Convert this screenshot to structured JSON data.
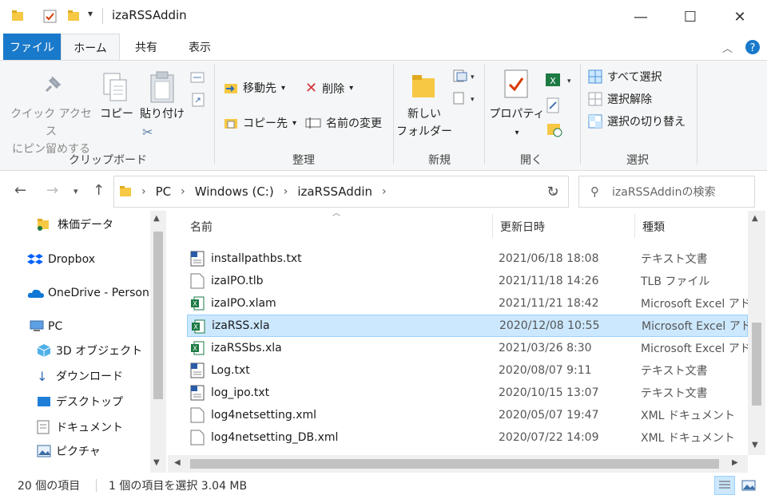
{
  "window": {
    "title": "izaRSSAddin",
    "minimize": "—",
    "maximize": "☐",
    "close": "✕"
  },
  "ribbon_tabs": [
    {
      "label": "ファイル"
    },
    {
      "label": "ホーム"
    },
    {
      "label": "共有"
    },
    {
      "label": "表示"
    }
  ],
  "ribbon": {
    "clipboard": {
      "pin": "クイック アクセス\nにピン留めする",
      "copy": "コピー",
      "paste": "貼り付け",
      "label": "クリップボード"
    },
    "organize": {
      "move_to": "移動先",
      "copy_to": "コピー先",
      "delete": "削除",
      "rename": "名前の変更",
      "label": "整理"
    },
    "new": {
      "new_folder": "新しい\nフォルダー",
      "label": "新規"
    },
    "open": {
      "properties": "プロパティ",
      "label": "開く"
    },
    "select": {
      "select_all": "すべて選択",
      "select_none": "選択解除",
      "invert": "選択の切り替え",
      "label": "選択"
    }
  },
  "address": {
    "crumbs": [
      "PC",
      "Windows (C:)",
      "izaRSSAddin"
    ],
    "search_placeholder": "izaRSSAddinの検索"
  },
  "nav_pane": {
    "items": [
      {
        "label": "株価データ",
        "icon": "folder-icon"
      },
      {
        "label": "Dropbox",
        "icon": "dropbox-icon"
      },
      {
        "label": "OneDrive - Person",
        "icon": "onedrive-icon"
      },
      {
        "label": "PC",
        "icon": "pc-icon"
      },
      {
        "label": "3D オブジェクト",
        "icon": "3d-objects-icon"
      },
      {
        "label": "ダウンロード",
        "icon": "download-icon"
      },
      {
        "label": "デスクトップ",
        "icon": "desktop-icon"
      },
      {
        "label": "ドキュメント",
        "icon": "documents-icon"
      },
      {
        "label": "ピクチャ",
        "icon": "pictures-icon"
      }
    ]
  },
  "columns": {
    "name": "名前",
    "date": "更新日時",
    "type": "種類"
  },
  "files": [
    {
      "name": "installpathbs.txt",
      "date": "2021/06/18 18:08",
      "type": "テキスト文書",
      "icon": "text-file-icon"
    },
    {
      "name": "izaIPO.tlb",
      "date": "2021/11/18 14:26",
      "type": "TLB ファイル",
      "icon": "blank-file-icon"
    },
    {
      "name": "izaIPO.xlam",
      "date": "2021/11/21 18:42",
      "type": "Microsoft Excel アド",
      "icon": "excel-file-icon"
    },
    {
      "name": "izaRSS.xla",
      "date": "2020/12/08 10:55",
      "type": "Microsoft Excel アド",
      "icon": "excel-file-icon"
    },
    {
      "name": "izaRSSbs.xla",
      "date": "2021/03/26 8:30",
      "type": "Microsoft Excel アド",
      "icon": "excel-file-icon"
    },
    {
      "name": "Log.txt",
      "date": "2020/08/07 9:11",
      "type": "テキスト文書",
      "icon": "text-file-icon"
    },
    {
      "name": "log_ipo.txt",
      "date": "2020/10/15 13:07",
      "type": "テキスト文書",
      "icon": "text-file-icon"
    },
    {
      "name": "log4netsetting.xml",
      "date": "2020/05/07 19:47",
      "type": "XML ドキュメント",
      "icon": "blank-file-icon"
    },
    {
      "name": "log4netsetting_DB.xml",
      "date": "2020/07/22 14:09",
      "type": "XML ドキュメント",
      "icon": "blank-file-icon"
    }
  ],
  "selected_file": "izaRSS.xla",
  "status": {
    "count": "20 個の項目",
    "selection": "1 個の項目を選択  3.04 MB"
  },
  "colors": {
    "accent": "#1979ca",
    "selection": "#cce8ff",
    "excel": "#1d7a44",
    "folder": "#f6c844"
  }
}
